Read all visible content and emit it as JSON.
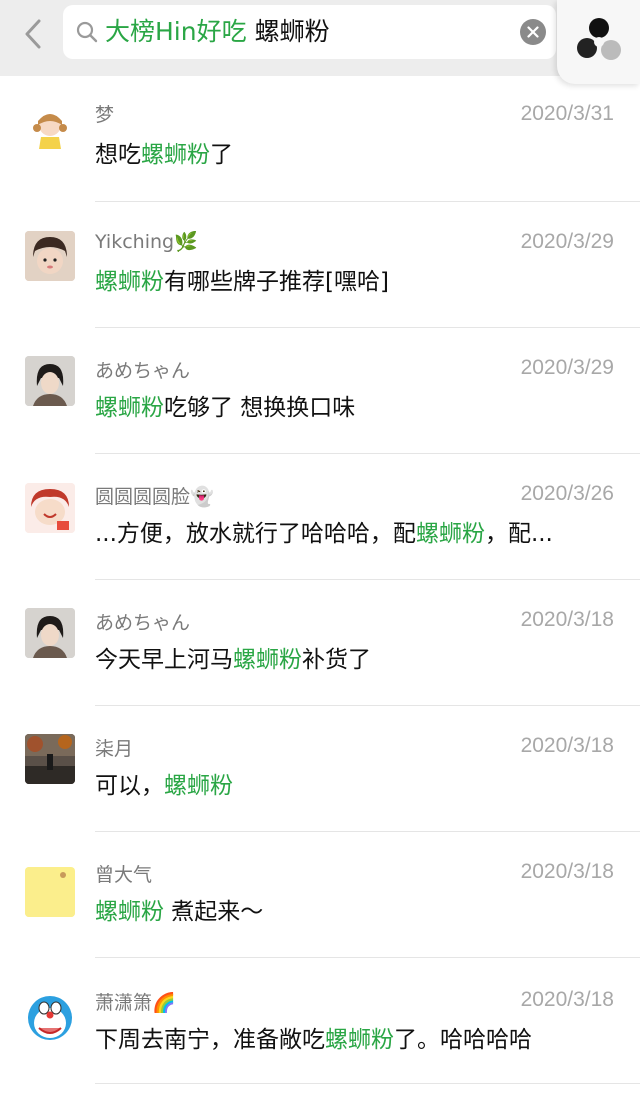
{
  "search": {
    "tag": "大榜Hin好吃",
    "keyword": "螺蛳粉"
  },
  "results": [
    {
      "name": "梦",
      "name_emoji": "",
      "date": "2020/3/31",
      "msg_before": "想吃",
      "msg_highlight": "螺蛳粉",
      "msg_after": "了"
    },
    {
      "name": "Yikching",
      "name_emoji": "🌿",
      "date": "2020/3/29",
      "msg_before": "",
      "msg_highlight": "螺蛳粉",
      "msg_after": "有哪些牌子推荐[嘿哈]"
    },
    {
      "name": "あめちゃん",
      "name_emoji": "",
      "date": "2020/3/29",
      "msg_before": "",
      "msg_highlight": "螺蛳粉",
      "msg_after": "吃够了 想换换口味"
    },
    {
      "name": "圆圆圆圆脸",
      "name_emoji": "👻",
      "date": "2020/3/26",
      "msg_before": "...方便，放水就行了哈哈哈，配",
      "msg_highlight": "螺蛳粉",
      "msg_after": "，配..."
    },
    {
      "name": "あめちゃん",
      "name_emoji": "",
      "date": "2020/3/18",
      "msg_before": "今天早上河马",
      "msg_highlight": "螺蛳粉",
      "msg_after": "补货了"
    },
    {
      "name": "柒月",
      "name_emoji": "",
      "date": "2020/3/18",
      "msg_before": "可以，",
      "msg_highlight": "螺蛳粉",
      "msg_after": ""
    },
    {
      "name": "曾大气",
      "name_emoji": "",
      "date": "2020/3/18",
      "msg_before": "",
      "msg_highlight": "螺蛳粉",
      "msg_after": " 煮起来～"
    },
    {
      "name": "萧潇箫",
      "name_emoji": "🌈",
      "date": "2020/3/18",
      "msg_before": "下周去南宁，准备敞吃",
      "msg_highlight": "螺蛳粉",
      "msg_after": "了。哈哈哈哈"
    }
  ],
  "colors": {
    "highlight": "#2aa645",
    "date": "#a8a8a8"
  },
  "icons": {
    "back": "chevron-left-icon",
    "search": "search-icon",
    "clear": "clear-icon",
    "menu": "mini-program-icon"
  }
}
